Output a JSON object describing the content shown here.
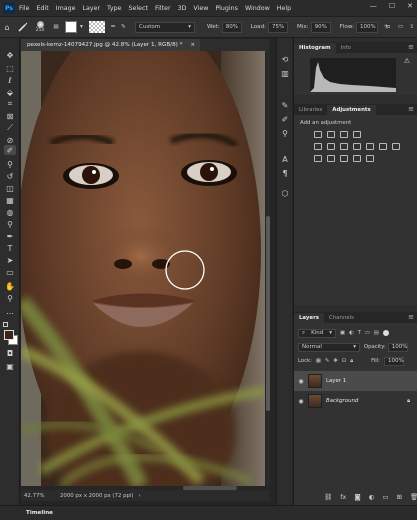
{
  "menu": {
    "app_logo": "Ps",
    "items": [
      "File",
      "Edit",
      "Image",
      "Layer",
      "Type",
      "Select",
      "Filter",
      "3D",
      "View",
      "Plugins",
      "Window",
      "Help"
    ],
    "window_controls": [
      "—",
      "☐",
      "✕"
    ]
  },
  "options": {
    "brush_size": "250",
    "mode": "Custom",
    "wet_label": "Wet:",
    "wet": "80%",
    "load_label": "Load:",
    "load": "75%",
    "mix_label": "Mix:",
    "mix": "90%",
    "flow_label": "Flow:",
    "flow": "100%"
  },
  "document": {
    "tab_title": "pexels-kemz-14079427.jpg @ 42.8% (Layer 1, RGB/8) *",
    "close": "×"
  },
  "status": {
    "zoom": "42.77%",
    "dimensions": "2000 px x 2000 px (72 ppi)",
    "arrow": "›"
  },
  "timeline": {
    "label": "Timeline"
  },
  "histogram_panel": {
    "tabs": [
      "Histogram",
      "Info"
    ],
    "warning": "⚠"
  },
  "adjustments_panel": {
    "tabs": [
      "Libraries",
      "Adjustments"
    ],
    "add_label": "Add an adjustment"
  },
  "layers_panel": {
    "tabs": [
      "Layers",
      "Channels"
    ],
    "kind_label": "Kind",
    "blend_mode": "Normal",
    "opacity_label": "Opacity:",
    "opacity": "100%",
    "lock_label": "Lock:",
    "fill_label": "Fill:",
    "fill": "100%",
    "layers": [
      {
        "name": "Layer 1",
        "selected": true,
        "italic": false
      },
      {
        "name": "Background",
        "selected": false,
        "italic": true
      }
    ],
    "footer_icons": [
      "link-icon",
      "fx-icon",
      "mask-icon",
      "adjustment-icon",
      "group-icon",
      "new-layer-icon",
      "trash-icon"
    ]
  },
  "colors": {
    "foreground": "#3b2418",
    "background": "#ffffff",
    "accent": "#31a8ff"
  }
}
